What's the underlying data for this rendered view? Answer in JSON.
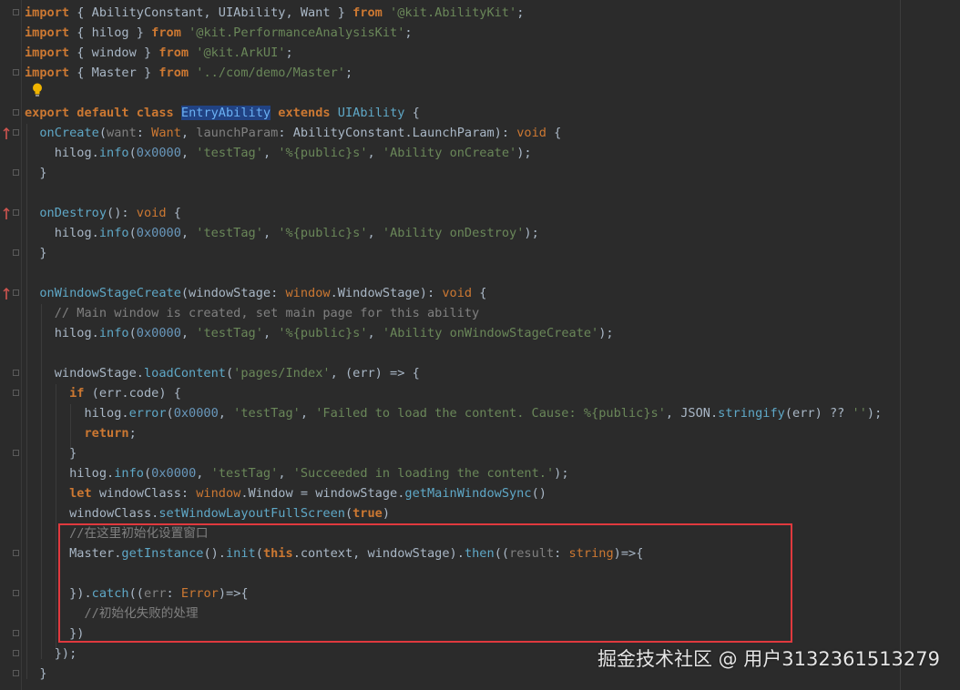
{
  "editor": {
    "lines": [
      [
        [
          "kw",
          "import"
        ],
        [
          "plain",
          " { AbilityConstant, UIAbility, Want } "
        ],
        [
          "kw",
          "from"
        ],
        [
          "plain",
          " "
        ],
        [
          "str",
          "'@kit.AbilityKit'"
        ],
        [
          "plain",
          ";"
        ]
      ],
      [
        [
          "kw",
          "import"
        ],
        [
          "plain",
          " { hilog } "
        ],
        [
          "kw",
          "from"
        ],
        [
          "plain",
          " "
        ],
        [
          "str",
          "'@kit.PerformanceAnalysisKit'"
        ],
        [
          "plain",
          ";"
        ]
      ],
      [
        [
          "kw",
          "import"
        ],
        [
          "plain",
          " { window } "
        ],
        [
          "kw",
          "from"
        ],
        [
          "plain",
          " "
        ],
        [
          "str",
          "'@kit.ArkUI'"
        ],
        [
          "plain",
          ";"
        ]
      ],
      [
        [
          "kw",
          "import"
        ],
        [
          "plain",
          " { Master } "
        ],
        [
          "kw",
          "from"
        ],
        [
          "plain",
          " "
        ],
        [
          "str",
          "'../com/demo/Master'"
        ],
        [
          "plain",
          ";"
        ]
      ],
      [],
      [
        [
          "kw",
          "export"
        ],
        [
          "plain",
          " "
        ],
        [
          "kw",
          "default"
        ],
        [
          "plain",
          " "
        ],
        [
          "kw",
          "class"
        ],
        [
          "plain",
          " "
        ],
        [
          "hl",
          "EntryAbility"
        ],
        [
          "plain",
          " "
        ],
        [
          "kw",
          "extends"
        ],
        [
          "plain",
          " "
        ],
        [
          "fname",
          "UIAbility"
        ],
        [
          "plain",
          " {"
        ]
      ],
      [
        [
          "plain",
          "  "
        ],
        [
          "fname",
          "onCreate"
        ],
        [
          "plain",
          "("
        ],
        [
          "param",
          "want"
        ],
        [
          "plain",
          ": "
        ],
        [
          "type",
          "Want"
        ],
        [
          "plain",
          ", "
        ],
        [
          "param",
          "launchParam"
        ],
        [
          "plain",
          ": AbilityConstant.LaunchParam): "
        ],
        [
          "kw2",
          "void"
        ],
        [
          "plain",
          " {"
        ]
      ],
      [
        [
          "plain",
          "    hilog."
        ],
        [
          "meth",
          "info"
        ],
        [
          "plain",
          "("
        ],
        [
          "num",
          "0x0000"
        ],
        [
          "plain",
          ", "
        ],
        [
          "str",
          "'testTag'"
        ],
        [
          "plain",
          ", "
        ],
        [
          "str",
          "'%{public}s'"
        ],
        [
          "plain",
          ", "
        ],
        [
          "str",
          "'Ability onCreate'"
        ],
        [
          "plain",
          ");"
        ]
      ],
      [
        [
          "plain",
          "  }"
        ]
      ],
      [],
      [
        [
          "plain",
          "  "
        ],
        [
          "fname",
          "onDestroy"
        ],
        [
          "plain",
          "(): "
        ],
        [
          "kw2",
          "void"
        ],
        [
          "plain",
          " {"
        ]
      ],
      [
        [
          "plain",
          "    hilog."
        ],
        [
          "meth",
          "info"
        ],
        [
          "plain",
          "("
        ],
        [
          "num",
          "0x0000"
        ],
        [
          "plain",
          ", "
        ],
        [
          "str",
          "'testTag'"
        ],
        [
          "plain",
          ", "
        ],
        [
          "str",
          "'%{public}s'"
        ],
        [
          "plain",
          ", "
        ],
        [
          "str",
          "'Ability onDestroy'"
        ],
        [
          "plain",
          ");"
        ]
      ],
      [
        [
          "plain",
          "  }"
        ]
      ],
      [],
      [
        [
          "plain",
          "  "
        ],
        [
          "fname",
          "onWindowStageCreate"
        ],
        [
          "plain",
          "(windowStage: "
        ],
        [
          "type",
          "window"
        ],
        [
          "plain",
          ".WindowStage): "
        ],
        [
          "kw2",
          "void"
        ],
        [
          "plain",
          " {"
        ]
      ],
      [
        [
          "cmt",
          "    // Main window is created, set main page for this ability"
        ]
      ],
      [
        [
          "plain",
          "    hilog."
        ],
        [
          "meth",
          "info"
        ],
        [
          "plain",
          "("
        ],
        [
          "num",
          "0x0000"
        ],
        [
          "plain",
          ", "
        ],
        [
          "str",
          "'testTag'"
        ],
        [
          "plain",
          ", "
        ],
        [
          "str",
          "'%{public}s'"
        ],
        [
          "plain",
          ", "
        ],
        [
          "str",
          "'Ability onWindowStageCreate'"
        ],
        [
          "plain",
          ");"
        ]
      ],
      [],
      [
        [
          "plain",
          "    windowStage."
        ],
        [
          "meth",
          "loadContent"
        ],
        [
          "plain",
          "("
        ],
        [
          "str",
          "'pages/Index'"
        ],
        [
          "plain",
          ", (err) => {"
        ]
      ],
      [
        [
          "plain",
          "      "
        ],
        [
          "kw",
          "if"
        ],
        [
          "plain",
          " (err.code) {"
        ]
      ],
      [
        [
          "plain",
          "        hilog."
        ],
        [
          "meth",
          "error"
        ],
        [
          "plain",
          "("
        ],
        [
          "num",
          "0x0000"
        ],
        [
          "plain",
          ", "
        ],
        [
          "str",
          "'testTag'"
        ],
        [
          "plain",
          ", "
        ],
        [
          "str",
          "'Failed to load the content. Cause: %{public}s'"
        ],
        [
          "plain",
          ", JSON."
        ],
        [
          "meth",
          "stringify"
        ],
        [
          "plain",
          "(err) ?? "
        ],
        [
          "str",
          "''"
        ],
        [
          "plain",
          ");"
        ]
      ],
      [
        [
          "plain",
          "        "
        ],
        [
          "kw",
          "return"
        ],
        [
          "plain",
          ";"
        ]
      ],
      [
        [
          "plain",
          "      }"
        ]
      ],
      [
        [
          "plain",
          "      hilog."
        ],
        [
          "meth",
          "info"
        ],
        [
          "plain",
          "("
        ],
        [
          "num",
          "0x0000"
        ],
        [
          "plain",
          ", "
        ],
        [
          "str",
          "'testTag'"
        ],
        [
          "plain",
          ", "
        ],
        [
          "str",
          "'Succeeded in loading the content.'"
        ],
        [
          "plain",
          ");"
        ]
      ],
      [
        [
          "plain",
          "      "
        ],
        [
          "kw",
          "let"
        ],
        [
          "plain",
          " windowClass: "
        ],
        [
          "type",
          "window"
        ],
        [
          "plain",
          ".Window = windowStage."
        ],
        [
          "meth",
          "getMainWindowSync"
        ],
        [
          "plain",
          "()"
        ]
      ],
      [
        [
          "plain",
          "      windowClass."
        ],
        [
          "meth",
          "setWindowLayoutFullScreen"
        ],
        [
          "plain",
          "("
        ],
        [
          "kw",
          "true"
        ],
        [
          "plain",
          ")"
        ]
      ],
      [
        [
          "cmt",
          "      //在这里初始化设置窗口"
        ]
      ],
      [
        [
          "plain",
          "      Master."
        ],
        [
          "meth",
          "getInstance"
        ],
        [
          "plain",
          "()."
        ],
        [
          "meth",
          "init"
        ],
        [
          "plain",
          "("
        ],
        [
          "kw",
          "this"
        ],
        [
          "plain",
          ".context, windowStage)."
        ],
        [
          "meth",
          "then"
        ],
        [
          "plain",
          "(("
        ],
        [
          "param",
          "result"
        ],
        [
          "plain",
          ": "
        ],
        [
          "type",
          "string"
        ],
        [
          "plain",
          ")=>{"
        ]
      ],
      [],
      [
        [
          "plain",
          "      })."
        ],
        [
          "meth",
          "catch"
        ],
        [
          "plain",
          "(("
        ],
        [
          "param",
          "err"
        ],
        [
          "plain",
          ": "
        ],
        [
          "type",
          "Error"
        ],
        [
          "plain",
          ")=>{"
        ]
      ],
      [
        [
          "cmt",
          "        //初始化失败的处理"
        ]
      ],
      [
        [
          "plain",
          "      })"
        ]
      ],
      [
        [
          "plain",
          "    });"
        ]
      ],
      [
        [
          "plain",
          "  }"
        ]
      ]
    ],
    "colors": {
      "background": "#2b2b2b",
      "keyword": "#cc7832",
      "string": "#6a8759",
      "number": "#6897bb",
      "method": "#5fa8c7",
      "comment": "#808080",
      "highlight_box": "#e0393e"
    },
    "gutter_markers": {
      "override_lines": [
        6,
        10,
        14
      ],
      "bulb_icon": "lightbulb-icon"
    }
  },
  "watermark": "掘金技术社区 @ 用户3132361513279"
}
